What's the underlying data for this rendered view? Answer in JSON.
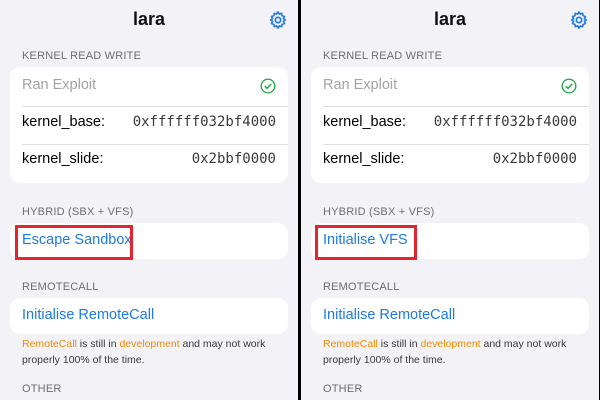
{
  "colors": {
    "accent": "#1e7ae0",
    "check": "#2fa84f",
    "highlight": "#e3262e",
    "warning_text": "#f08c00"
  },
  "panels": [
    {
      "title": "lara",
      "section_krw": "KERNEL READ WRITE",
      "ran_exploit": "Ran Exploit",
      "kernel_base_label": "kernel_base:",
      "kernel_base_value": "0xffffff032bf4000",
      "kernel_slide_label": "kernel_slide:",
      "kernel_slide_value": "0x2bbf0000",
      "section_hybrid": "HYBRID (SBX + VFS)",
      "hybrid_action": "Escape Sandbox",
      "section_remotecall": "REMOTECALL",
      "remotecall_action": "Initialise RemoteCall",
      "note_a": "RemoteCall",
      "note_b": " is still in ",
      "note_c": "development",
      "note_d": " and may not work properly 100% of the time.",
      "section_other": "OTHER"
    },
    {
      "title": "lara",
      "section_krw": "KERNEL READ WRITE",
      "ran_exploit": "Ran Exploit",
      "kernel_base_label": "kernel_base:",
      "kernel_base_value": "0xffffff032bf4000",
      "kernel_slide_label": "kernel_slide:",
      "kernel_slide_value": "0x2bbf0000",
      "section_hybrid": "HYBRID (SBX + VFS)",
      "hybrid_action": "Initialise VFS",
      "section_remotecall": "REMOTECALL",
      "remotecall_action": "Initialise RemoteCall",
      "note_a": "RemoteCall",
      "note_b": " is still in ",
      "note_c": "development",
      "note_d": " and may not work properly 100% of the time.",
      "section_other": "OTHER"
    }
  ],
  "icons": {
    "settings": "gear-icon",
    "status": "checkmark-circle-icon"
  }
}
